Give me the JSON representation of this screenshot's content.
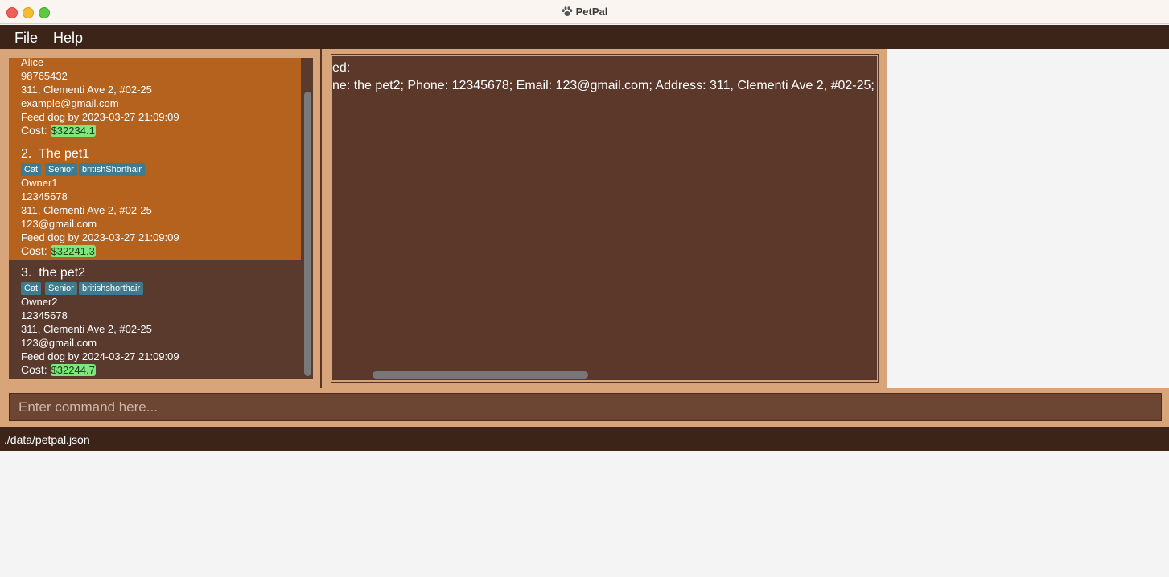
{
  "window": {
    "title": "PetPal"
  },
  "menu": {
    "file": "File",
    "help": "Help"
  },
  "pets": [
    {
      "tail_lines": [
        "Alice",
        "98765432",
        "311, Clementi Ave 2, #02-25",
        "example@gmail.com",
        "Feed dog by 2023-03-27 21:09:09"
      ],
      "cost_label": "Cost:",
      "cost_value": "$32234.1",
      "selected": true
    },
    {
      "index": "2.",
      "name": "The pet1",
      "tags": [
        "Cat",
        "Senior",
        "britishShorthair"
      ],
      "owner": "Owner1",
      "phone": "12345678",
      "address": "311, Clementi Ave 2, #02-25",
      "email": "123@gmail.com",
      "reminder": "Feed dog by 2023-03-27 21:09:09",
      "cost_label": "Cost:",
      "cost_value": "$32241.3",
      "selected": true
    },
    {
      "index": "3.",
      "name": "the pet2",
      "tags": [
        "Cat",
        "Senior",
        "britishshorthair"
      ],
      "owner": "Owner2",
      "phone": "12345678",
      "address": "311, Clementi Ave 2, #02-25",
      "email": "123@gmail.com",
      "reminder": "Feed dog by 2024-03-27 21:09:09",
      "cost_label": "Cost:",
      "cost_value": "$32244.7",
      "selected": false
    }
  ],
  "result": {
    "line1": "ed:",
    "line2": "ne: the pet2; Phone: 12345678; Email: 123@gmail.com; Address: 311, Clementi Ave 2, #02-25;"
  },
  "command": {
    "placeholder": "Enter command here..."
  },
  "status": {
    "path": "./data/petpal.json"
  },
  "colors": {
    "menubar": "#3d2418",
    "panel": "#d8a57a",
    "selected_card": "#b5621f",
    "card": "#5b3a2e",
    "tag": "#3e7b91",
    "cost_badge": "#7ee67a"
  },
  "icons": {
    "app": "paw-icon"
  }
}
